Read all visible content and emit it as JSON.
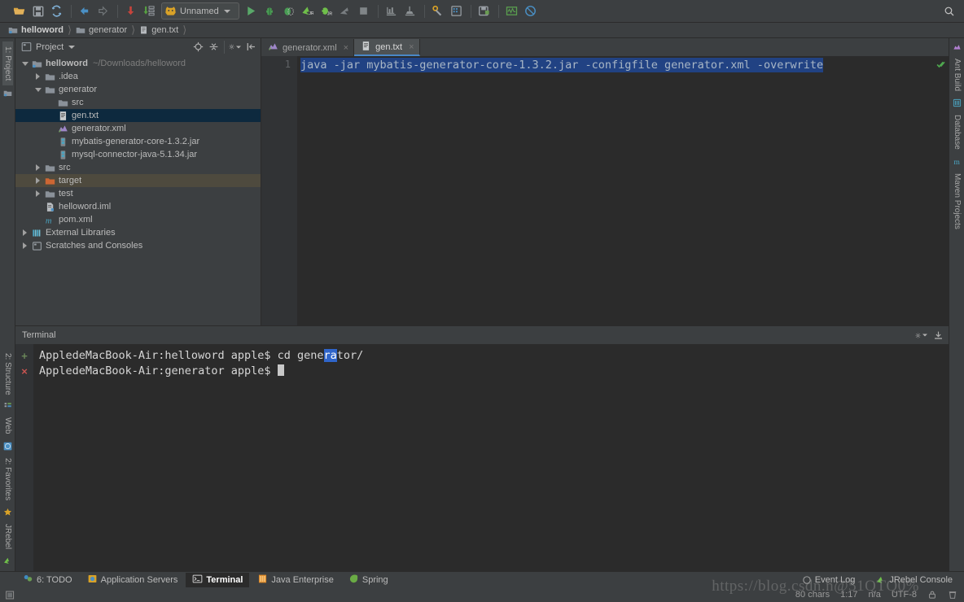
{
  "toolbar": {
    "icons": [
      {
        "name": "open-folder-icon",
        "glyph": "folder-open"
      },
      {
        "name": "save-all-icon",
        "glyph": "floppy"
      },
      {
        "name": "synchronize-icon",
        "glyph": "sync"
      },
      {
        "name": "back-icon",
        "glyph": "arrow-left"
      },
      {
        "name": "forward-icon",
        "glyph": "arrow-right"
      },
      {
        "name": "update-project-icon",
        "glyph": "update"
      },
      {
        "name": "commit-changes-icon",
        "glyph": "commit"
      }
    ],
    "run_config": "Unnamed",
    "run_config_icon": "cat-icon",
    "run_icon": "run-icon",
    "debug_icon": "debug-icon",
    "coverage_icon": "coverage-icon",
    "jrebel_run_icon": "jrebel-run-icon",
    "jrebel_debug_icon": "jrebel-debug-icon",
    "stop_icon": "stop-icon",
    "settings_icon": "settings-icon",
    "project_structure_icon": "project-structure-icon",
    "save_icon": "save-icon",
    "monitor_icon": "monitor-icon",
    "disable_icon": "disable-icon",
    "search_icon": "search-icon"
  },
  "breadcrumb": [
    {
      "label": "helloword",
      "icon": "module-icon",
      "bold": true
    },
    {
      "label": "generator",
      "icon": "folder-icon",
      "bold": false
    },
    {
      "label": "gen.txt",
      "icon": "file-icon",
      "bold": false
    }
  ],
  "left_rail": {
    "top": [
      {
        "label": "1: Project",
        "icon": "project-icon",
        "selected": true
      }
    ],
    "bottom": [
      {
        "label": "2: Structure",
        "icon": "structure-icon"
      },
      {
        "label": "Web",
        "icon": "web-icon"
      },
      {
        "label": "2: Favorites",
        "icon": "star-icon"
      },
      {
        "label": "JRebel",
        "icon": "jrebel-icon"
      }
    ]
  },
  "right_rail": {
    "items": [
      {
        "label": "Ant Build",
        "icon": "ant-icon"
      },
      {
        "label": "Database",
        "icon": "database-icon"
      },
      {
        "label": "Maven Projects",
        "icon": "maven-icon"
      }
    ]
  },
  "project_panel": {
    "title": "Project",
    "head_icons": [
      {
        "name": "locate-icon"
      },
      {
        "name": "collapse-all-icon"
      },
      {
        "name": "settings-gear-icon"
      },
      {
        "name": "hide-panel-icon"
      }
    ],
    "tree": [
      {
        "label": "helloword",
        "sub": "~/Downloads/helloword",
        "depth": 0,
        "arrow": "open",
        "icon": "module-icon",
        "bold": true,
        "state": "none"
      },
      {
        "label": ".idea",
        "sub": "",
        "depth": 1,
        "arrow": "closed",
        "icon": "folder-icon",
        "bold": false,
        "state": "none"
      },
      {
        "label": "generator",
        "sub": "",
        "depth": 1,
        "arrow": "open",
        "icon": "folder-icon",
        "bold": false,
        "state": "none"
      },
      {
        "label": "src",
        "sub": "",
        "depth": 2,
        "arrow": "none",
        "icon": "folder-icon",
        "bold": false,
        "state": "none"
      },
      {
        "label": "gen.txt",
        "sub": "",
        "depth": 2,
        "arrow": "none",
        "icon": "text-file-icon",
        "bold": false,
        "state": "selected"
      },
      {
        "label": "generator.xml",
        "sub": "",
        "depth": 2,
        "arrow": "none",
        "icon": "ant-xml-icon",
        "bold": false,
        "state": "none"
      },
      {
        "label": "mybatis-generator-core-1.3.2.jar",
        "sub": "",
        "depth": 2,
        "arrow": "none",
        "icon": "jar-icon",
        "bold": false,
        "state": "none"
      },
      {
        "label": "mysql-connector-java-5.1.34.jar",
        "sub": "",
        "depth": 2,
        "arrow": "none",
        "icon": "jar-icon",
        "bold": false,
        "state": "none"
      },
      {
        "label": "src",
        "sub": "",
        "depth": 1,
        "arrow": "closed",
        "icon": "folder-icon",
        "bold": false,
        "state": "none"
      },
      {
        "label": "target",
        "sub": "",
        "depth": 1,
        "arrow": "closed",
        "icon": "folder-orange-icon",
        "bold": false,
        "state": "highlight"
      },
      {
        "label": "test",
        "sub": "",
        "depth": 1,
        "arrow": "closed",
        "icon": "folder-icon",
        "bold": false,
        "state": "none"
      },
      {
        "label": "helloword.iml",
        "sub": "",
        "depth": 1,
        "arrow": "none",
        "icon": "iml-icon",
        "bold": false,
        "state": "none"
      },
      {
        "label": "pom.xml",
        "sub": "",
        "depth": 1,
        "arrow": "none",
        "icon": "maven-pom-icon",
        "bold": false,
        "state": "none"
      },
      {
        "label": "External Libraries",
        "sub": "",
        "depth": 0,
        "arrow": "closed",
        "icon": "libraries-icon",
        "bold": false,
        "state": "none"
      },
      {
        "label": "Scratches and Consoles",
        "sub": "",
        "depth": 0,
        "arrow": "closed",
        "icon": "scratches-icon",
        "bold": false,
        "state": "none"
      }
    ]
  },
  "editor": {
    "tabs": [
      {
        "label": "generator.xml",
        "icon": "ant-xml-icon",
        "active": false,
        "close": "×"
      },
      {
        "label": "gen.txt",
        "icon": "text-file-icon",
        "active": true,
        "close": "×"
      }
    ],
    "line_number": "1",
    "code_line": "java -jar mybatis-generator-core-1.3.2.jar -configfile generator.xml -overwrite",
    "inspection_status": "ok-check-icon"
  },
  "terminal": {
    "title": "Terminal",
    "head_icons": [
      {
        "name": "settings-gear-icon"
      },
      {
        "name": "hide-panel-icon"
      }
    ],
    "lines": [
      {
        "mark": "+",
        "pre": "AppledeMacBook-Air:helloword apple$ cd gene",
        "sel": "ra",
        "post": "tor/",
        "cursor": false
      },
      {
        "mark": "×",
        "pre": "AppledeMacBook-Air:generator apple$ ",
        "sel": "",
        "post": "",
        "cursor": true
      }
    ]
  },
  "status_tabs": [
    {
      "label": "6: TODO",
      "icon": "todo-icon",
      "selected": false,
      "mnemonic": "6"
    },
    {
      "label": "Application Servers",
      "icon": "app-servers-icon",
      "selected": false,
      "mnemonic": ""
    },
    {
      "label": "Terminal",
      "icon": "terminal-icon",
      "selected": true,
      "mnemonic": ""
    },
    {
      "label": "Java Enterprise",
      "icon": "java-ee-icon",
      "selected": false,
      "mnemonic": ""
    },
    {
      "label": "Spring",
      "icon": "spring-icon",
      "selected": false,
      "mnemonic": ""
    }
  ],
  "status_right": [
    {
      "label": "Event Log",
      "icon": "event-log-icon"
    },
    {
      "label": "JRebel Console",
      "icon": "jrebel-icon"
    }
  ],
  "status_info": {
    "chars": "80 chars",
    "caret": "1:17",
    "line_sep": "n/a",
    "encoding": "UTF-8",
    "lock_icon": "lock-icon",
    "trash_icon": "trash-icon"
  },
  "watermark": "https://blog.csdn.n@51QTQ0%",
  "colors": {
    "bg": "#3c3f41",
    "editor_bg": "#2b2b2b",
    "selection": "#214283",
    "tree_selected": "#0d293e",
    "tree_highlight": "#4e4a3e",
    "accent_green": "#6a8759",
    "accent_red": "#c75450",
    "orange": "#cc7832"
  }
}
